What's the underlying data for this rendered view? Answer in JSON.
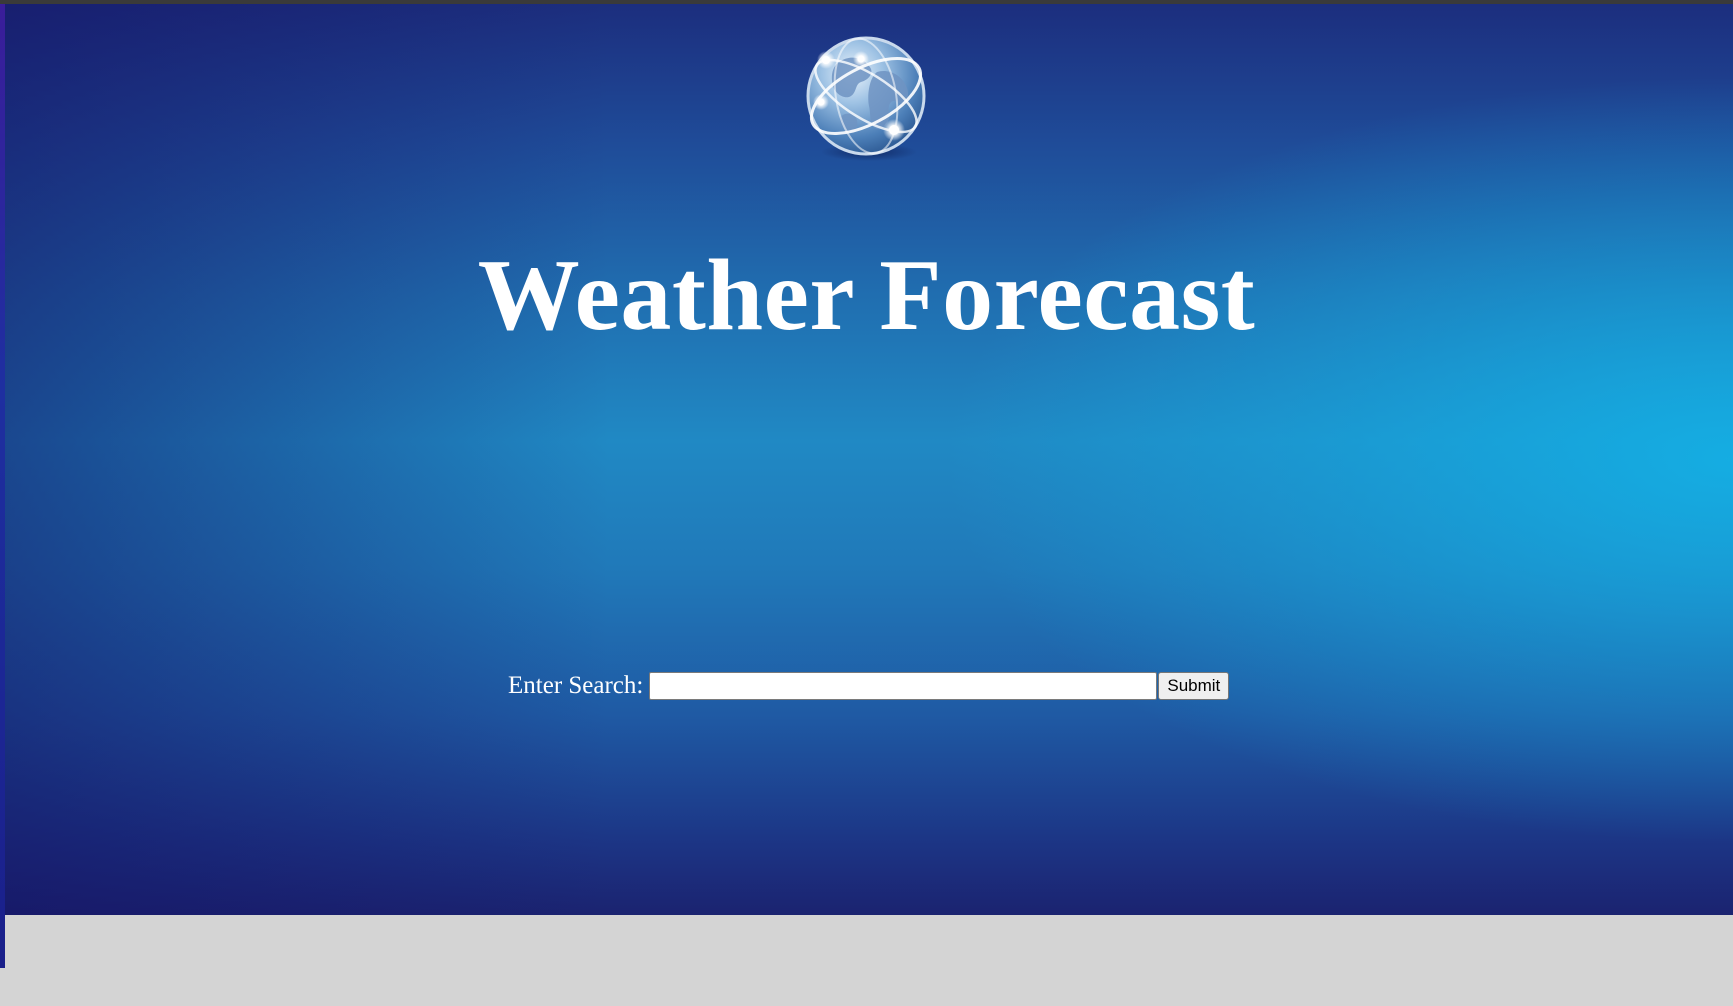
{
  "page": {
    "title": "Weather Forecast"
  },
  "logo": {
    "icon": "globe-network-icon"
  },
  "search": {
    "label": "Enter Search:",
    "value": "",
    "placeholder": "",
    "submit_label": "Submit"
  },
  "colors": {
    "hero_top": "#1c2e7e",
    "hero_mid": "#2089c4",
    "hero_glow": "#14afe4",
    "footer": "#d4d4d4",
    "title_text": "#ffffff"
  }
}
